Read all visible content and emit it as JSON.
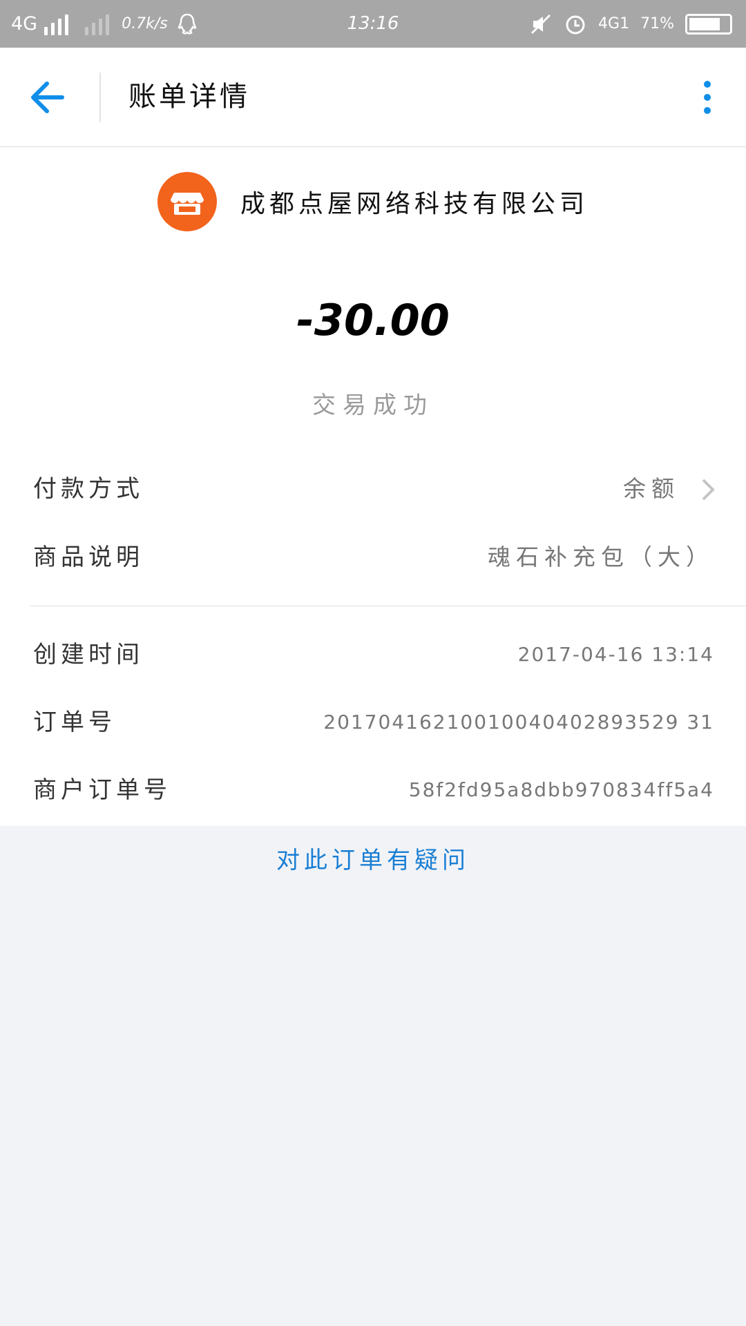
{
  "status_bar": {
    "network": "4G",
    "speed": "0.7k/s",
    "time": "13:16",
    "right_network": "4G1",
    "battery_text": "71%"
  },
  "header": {
    "title": "账单详情",
    "back_icon": "arrow-left-icon",
    "more_icon": "more-vertical-icon",
    "accent_color": "#108ee9"
  },
  "merchant": {
    "name": "成都点屋网络科技有限公司",
    "logo_icon": "store-icon",
    "logo_color": "#f2631b"
  },
  "amount": "-30.00",
  "status": "交易成功",
  "details": [
    {
      "label": "付款方式",
      "value": "余额"
    },
    {
      "label": "商品说明",
      "value": "魂石补充包（大）"
    },
    {
      "label": "创建时间",
      "value": "2017-04-16 13:14"
    },
    {
      "label": "订单号",
      "value": "20170416210010040402893529 31"
    },
    {
      "label": "商户订单号",
      "value": "58f2fd95a8dbb970834ff5a4"
    }
  ],
  "question_link": "对此订单有疑问"
}
